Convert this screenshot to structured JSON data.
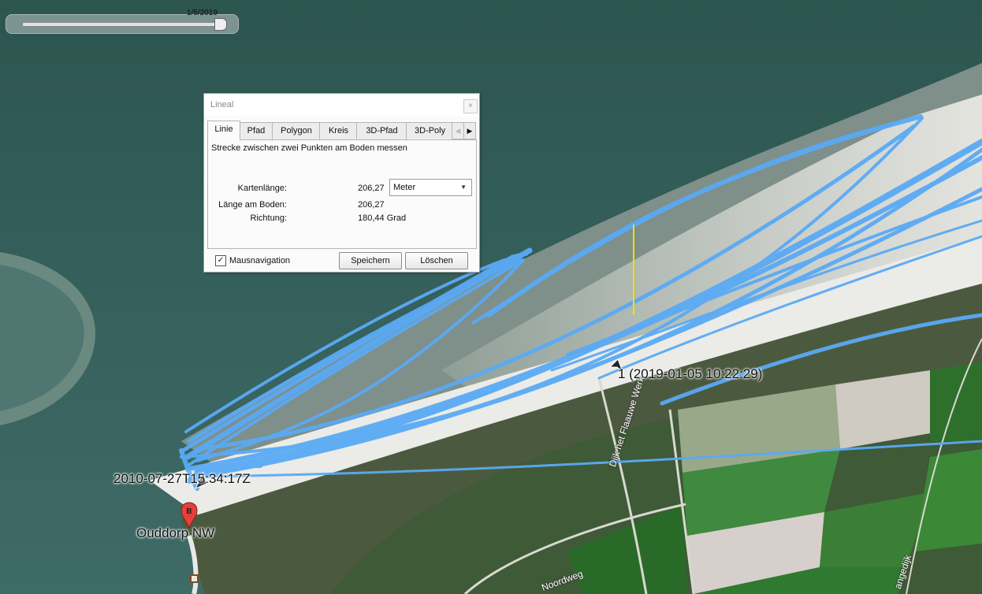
{
  "time_slider": {
    "date": "1/5/2019",
    "position": 0.97
  },
  "ruler_dialog": {
    "title": "Lineal",
    "close_glyph": "×",
    "tabs": [
      {
        "label": "Linie",
        "active": true
      },
      {
        "label": "Pfad"
      },
      {
        "label": "Polygon"
      },
      {
        "label": "Kreis"
      },
      {
        "label": "3D-Pfad"
      },
      {
        "label": "3D-Poly"
      }
    ],
    "description": "Strecke zwischen zwei Punkten am Boden messen",
    "map_length_label": "Kartenlänge:",
    "map_length_value": "206,27",
    "unit": "Meter",
    "ground_length_label": "Länge am Boden:",
    "ground_length_value": "206,27",
    "heading_label": "Richtung:",
    "heading_value": "180,44 Grad",
    "mouse_nav_label": "Mausnavigation",
    "mouse_nav_checked": true,
    "save_label": "Speichern",
    "delete_label": "Löschen"
  },
  "map": {
    "track_start_label": "2010-07-27T15:34:17Z",
    "waypoint_label": "1 (2019-01-05 10:22:29)",
    "placemark_letter": "B",
    "placemark_label": "Ouddorp NW",
    "roads": [
      "Dijk het Flaauwe Werk",
      "Noordweg",
      "angedijk"
    ]
  },
  "colors": {
    "track": "#5aaaf5",
    "ruler_line": "#f0e000",
    "placemark": "#e2413a"
  }
}
